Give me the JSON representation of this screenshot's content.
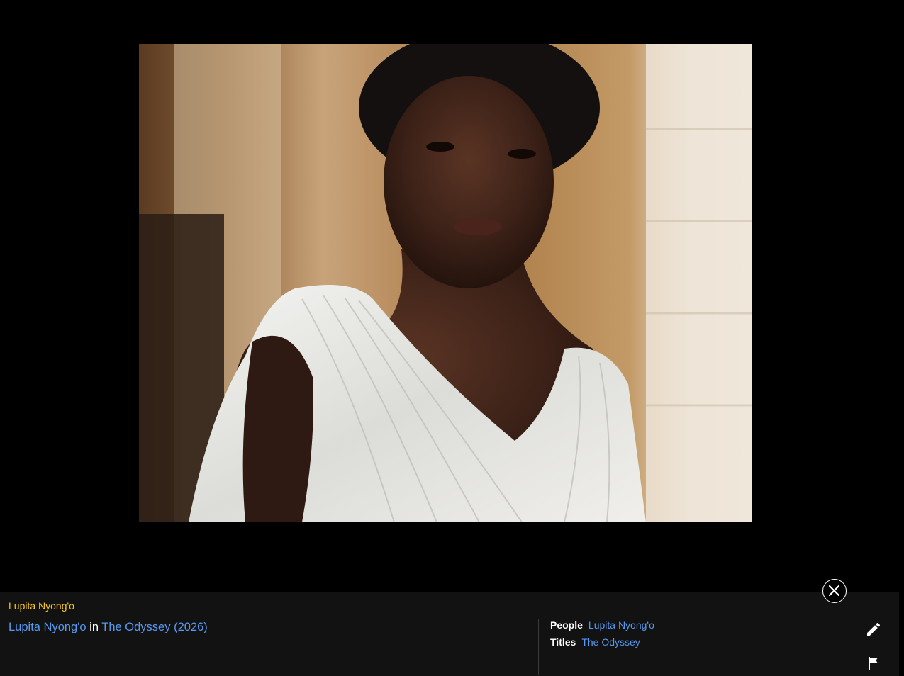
{
  "photo": {
    "alt_subject": "portrait-photo"
  },
  "panel": {
    "kicker": "Lupita Nyong'o",
    "caption": {
      "person_link": "Lupita Nyong'o",
      "connector": " in ",
      "title_link": "The Odyssey (2026)"
    },
    "people": {
      "label": "People",
      "value": "Lupita Nyong'o"
    },
    "titles": {
      "label": "Titles",
      "value": "The Odyssey"
    }
  },
  "icons": {
    "close": "close-icon",
    "edit": "pencil-icon",
    "flag": "flag-icon"
  },
  "colors": {
    "accent": "#f5c518",
    "link": "#5799ef",
    "panel_bg": "#121212"
  }
}
